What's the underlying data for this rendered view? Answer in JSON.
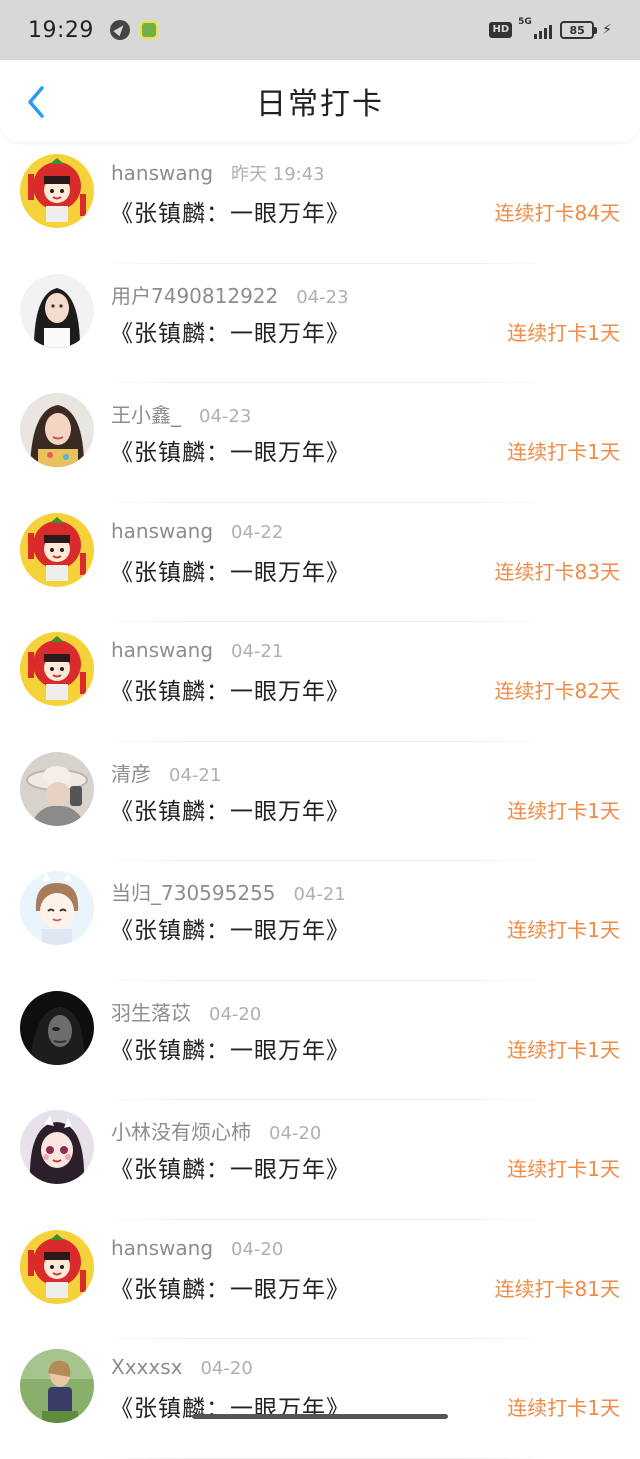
{
  "status_bar": {
    "time": "19:29",
    "network": "5G",
    "hd": "HD",
    "battery": "85"
  },
  "header": {
    "title": "日常打卡"
  },
  "colors": {
    "accent": "#2b9cf0",
    "streak": "#f08a44"
  },
  "entries": [
    {
      "username": "hanswang",
      "date": "昨天 19:43",
      "book": "《张镇麟：一眼万年》",
      "streak": "连续打卡84天",
      "avatar": "tomato"
    },
    {
      "username": "用户7490812922",
      "date": "04-23",
      "book": "《张镇麟：一眼万年》",
      "streak": "连续打卡1天",
      "avatar": "girl-dark"
    },
    {
      "username": "王小鑫_",
      "date": "04-23",
      "book": "《张镇麟：一眼万年》",
      "streak": "连续打卡1天",
      "avatar": "girl-light"
    },
    {
      "username": "hanswang",
      "date": "04-22",
      "book": "《张镇麟：一眼万年》",
      "streak": "连续打卡83天",
      "avatar": "tomato"
    },
    {
      "username": "hanswang",
      "date": "04-21",
      "book": "《张镇麟：一眼万年》",
      "streak": "连续打卡82天",
      "avatar": "tomato"
    },
    {
      "username": "清彦",
      "date": "04-21",
      "book": "《张镇麟：一眼万年》",
      "streak": "连续打卡1天",
      "avatar": "hat"
    },
    {
      "username": "当归_730595255",
      "date": "04-21",
      "book": "《张镇麟：一眼万年》",
      "streak": "连续打卡1天",
      "avatar": "anime-boy"
    },
    {
      "username": "羽生落苡",
      "date": "04-20",
      "book": "《张镇麟：一眼万年》",
      "streak": "连续打卡1天",
      "avatar": "dark-portrait"
    },
    {
      "username": "小林没有烦心柿",
      "date": "04-20",
      "book": "《张镇麟：一眼万年》",
      "streak": "连续打卡1天",
      "avatar": "anime-girl"
    },
    {
      "username": "hanswang",
      "date": "04-20",
      "book": "《张镇麟：一眼万年》",
      "streak": "连续打卡81天",
      "avatar": "tomato"
    },
    {
      "username": "Xxxxsx",
      "date": "04-20",
      "book": "《张镇麟：一眼万年》",
      "streak": "连续打卡1天",
      "avatar": "outdoor"
    }
  ]
}
